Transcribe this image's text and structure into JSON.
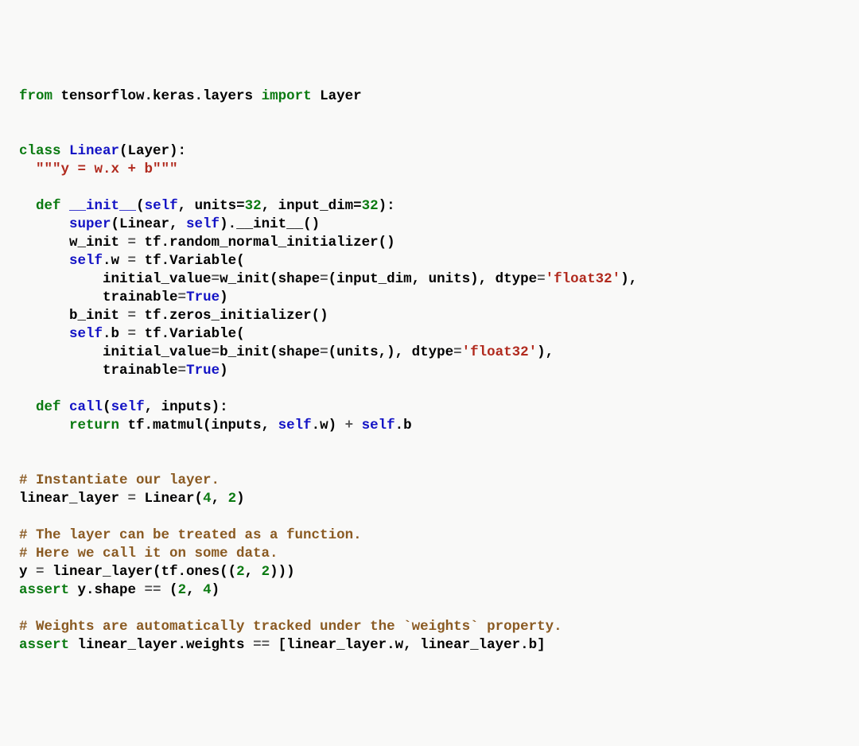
{
  "code": {
    "tokens": [
      [
        [
          "kw",
          "from"
        ],
        [
          "plain",
          " tensorflow.keras.layers "
        ],
        [
          "kw",
          "import"
        ],
        [
          "plain",
          " Layer"
        ]
      ],
      [],
      [],
      [
        [
          "kw",
          "class"
        ],
        [
          "plain",
          " "
        ],
        [
          "nm",
          "Linear"
        ],
        [
          "plain",
          "(Layer):"
        ]
      ],
      [
        [
          "plain",
          "  "
        ],
        [
          "str",
          "\"\"\"y = w.x + b\"\"\""
        ]
      ],
      [],
      [
        [
          "plain",
          "  "
        ],
        [
          "kw",
          "def"
        ],
        [
          "plain",
          " "
        ],
        [
          "nm",
          "__init__"
        ],
        [
          "plain",
          "("
        ],
        [
          "nm",
          "self"
        ],
        [
          "plain",
          ", units="
        ],
        [
          "num",
          "32"
        ],
        [
          "plain",
          ", input_dim="
        ],
        [
          "num",
          "32"
        ],
        [
          "plain",
          "):"
        ]
      ],
      [
        [
          "plain",
          "      "
        ],
        [
          "nm",
          "super"
        ],
        [
          "plain",
          "(Linear, "
        ],
        [
          "nm",
          "self"
        ],
        [
          "plain",
          ").__init__()"
        ]
      ],
      [
        [
          "plain",
          "      w_init "
        ],
        [
          "op",
          "="
        ],
        [
          "plain",
          " tf.random_normal_initializer()"
        ]
      ],
      [
        [
          "plain",
          "      "
        ],
        [
          "nm",
          "self"
        ],
        [
          "plain",
          ".w "
        ],
        [
          "op",
          "="
        ],
        [
          "plain",
          " tf.Variable("
        ]
      ],
      [
        [
          "plain",
          "          initial_value"
        ],
        [
          "op",
          "="
        ],
        [
          "plain",
          "w_init(shape"
        ],
        [
          "op",
          "="
        ],
        [
          "plain",
          "(input_dim, units), dtype"
        ],
        [
          "op",
          "="
        ],
        [
          "str",
          "'float32'"
        ],
        [
          "plain",
          "),"
        ]
      ],
      [
        [
          "plain",
          "          trainable"
        ],
        [
          "op",
          "="
        ],
        [
          "nm",
          "True"
        ],
        [
          "plain",
          ")"
        ]
      ],
      [
        [
          "plain",
          "      b_init "
        ],
        [
          "op",
          "="
        ],
        [
          "plain",
          " tf.zeros_initializer()"
        ]
      ],
      [
        [
          "plain",
          "      "
        ],
        [
          "nm",
          "self"
        ],
        [
          "plain",
          ".b "
        ],
        [
          "op",
          "="
        ],
        [
          "plain",
          " tf.Variable("
        ]
      ],
      [
        [
          "plain",
          "          initial_value"
        ],
        [
          "op",
          "="
        ],
        [
          "plain",
          "b_init(shape"
        ],
        [
          "op",
          "="
        ],
        [
          "plain",
          "(units,), dtype"
        ],
        [
          "op",
          "="
        ],
        [
          "str",
          "'float32'"
        ],
        [
          "plain",
          "),"
        ]
      ],
      [
        [
          "plain",
          "          trainable"
        ],
        [
          "op",
          "="
        ],
        [
          "nm",
          "True"
        ],
        [
          "plain",
          ")"
        ]
      ],
      [],
      [
        [
          "plain",
          "  "
        ],
        [
          "kw",
          "def"
        ],
        [
          "plain",
          " "
        ],
        [
          "nm",
          "call"
        ],
        [
          "plain",
          "("
        ],
        [
          "nm",
          "self"
        ],
        [
          "plain",
          ", inputs):"
        ]
      ],
      [
        [
          "plain",
          "      "
        ],
        [
          "kw",
          "return"
        ],
        [
          "plain",
          " tf.matmul(inputs, "
        ],
        [
          "nm",
          "self"
        ],
        [
          "plain",
          ".w) "
        ],
        [
          "op",
          "+"
        ],
        [
          "plain",
          " "
        ],
        [
          "nm",
          "self"
        ],
        [
          "plain",
          ".b"
        ]
      ],
      [],
      [],
      [
        [
          "cm",
          "# Instantiate our layer."
        ]
      ],
      [
        [
          "plain",
          "linear_layer "
        ],
        [
          "op",
          "="
        ],
        [
          "plain",
          " Linear("
        ],
        [
          "num",
          "4"
        ],
        [
          "plain",
          ", "
        ],
        [
          "num",
          "2"
        ],
        [
          "plain",
          ")"
        ]
      ],
      [],
      [
        [
          "cm",
          "# The layer can be treated as a function."
        ]
      ],
      [
        [
          "cm",
          "# Here we call it on some data."
        ]
      ],
      [
        [
          "plain",
          "y "
        ],
        [
          "op",
          "="
        ],
        [
          "plain",
          " linear_layer(tf.ones(("
        ],
        [
          "num",
          "2"
        ],
        [
          "plain",
          ", "
        ],
        [
          "num",
          "2"
        ],
        [
          "plain",
          ")))"
        ]
      ],
      [
        [
          "kw",
          "assert"
        ],
        [
          "plain",
          " y.shape "
        ],
        [
          "op",
          "=="
        ],
        [
          "plain",
          " ("
        ],
        [
          "num",
          "2"
        ],
        [
          "plain",
          ", "
        ],
        [
          "num",
          "4"
        ],
        [
          "plain",
          ")"
        ]
      ],
      [],
      [
        [
          "cm",
          "# Weights are automatically tracked under the `weights` property."
        ]
      ],
      [
        [
          "kw",
          "assert"
        ],
        [
          "plain",
          " linear_layer.weights "
        ],
        [
          "op",
          "=="
        ],
        [
          "plain",
          " [linear_layer.w, linear_layer.b]"
        ]
      ]
    ]
  }
}
